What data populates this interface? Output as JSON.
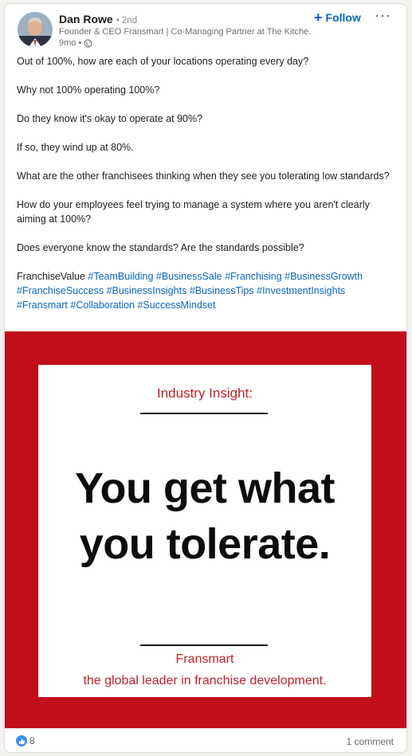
{
  "post": {
    "author": {
      "name": "Dan Rowe",
      "degree": "• 2nd",
      "headline": "Founder & CEO Fransmart | Co-Managing Partner at The Kitche...",
      "time": "9mo •"
    },
    "follow_label": "Follow",
    "follow_plus": "+",
    "more_label": "···",
    "paragraphs": [
      "Out of 100%, how are each of your locations operating every day?",
      "Why not 100% operating 100%?",
      "Do they know it's okay to operate at 90%?",
      "If so, they wind up at 80%.",
      "What are the other franchisees thinking when they see you tolerating low standards?",
      "How do your employees feel trying to manage a system where you aren't clearly aiming at 100%?",
      "Does everyone know the standards? Are the standards possible?"
    ],
    "hashtag_prefix": "FranchiseValue ",
    "hashtags": [
      "#TeamBuilding",
      "#BusinessSale",
      "#Franchising",
      "#BusinessGrowth",
      "#FranchiseSuccess",
      "#BusinessInsights",
      "#BusinessTips",
      "#InvestmentInsights",
      "#Fransmart",
      "#Collaboration",
      "#SuccessMindset"
    ]
  },
  "image": {
    "header": "Industry Insight:",
    "headline_line1": "You get what",
    "headline_line2": "you tolerate.",
    "brand": "Fransmart",
    "tagline": "the global leader in franchise development."
  },
  "footer": {
    "reaction_count": "8",
    "comments": "1 comment"
  },
  "colors": {
    "accent": "#0a66c2",
    "brand_red": "#c20e1a",
    "text_red": "#c0222b"
  },
  "icons": [
    "globe-icon",
    "like-reaction-icon",
    "more-options-icon"
  ]
}
